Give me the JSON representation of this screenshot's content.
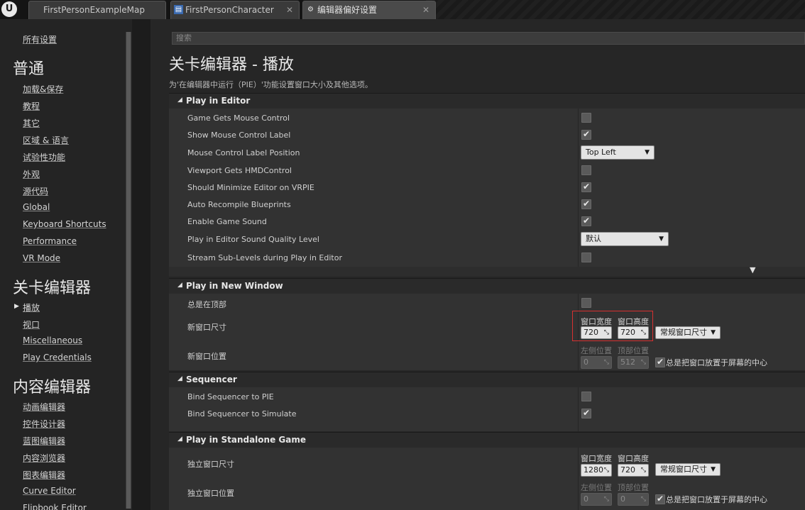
{
  "tabs": [
    {
      "label": "FirstPersonExampleMap",
      "icon": "level-icon"
    },
    {
      "label": "FirstPersonCharacter",
      "icon": "blueprint-icon"
    },
    {
      "label": "编辑器偏好设置",
      "icon": "settings-icon",
      "active": true
    }
  ],
  "sidebar": {
    "top_item": "所有设置",
    "sections": [
      {
        "heading": "普通",
        "items": [
          "加载&保存",
          "教程",
          "其它",
          "区域 & 语言",
          "试验性功能",
          "外观",
          "源代码",
          "Global",
          "Keyboard Shortcuts",
          "Performance",
          "VR Mode"
        ]
      },
      {
        "heading": "关卡编辑器",
        "items": [
          "播放",
          "视口",
          "Miscellaneous",
          "Play Credentials"
        ]
      },
      {
        "heading": "内容编辑器",
        "items": [
          "动画编辑器",
          "控件设计器",
          "蓝图编辑器",
          "内容浏览器",
          "图表编辑器",
          "Curve Editor",
          "Flipbook Editor"
        ]
      }
    ]
  },
  "main": {
    "search_placeholder": "搜索",
    "title": "关卡编辑器 - 播放",
    "description": "为'在编辑器中运行（PIE）'功能设置窗口大小及其他选项。",
    "play_in_editor": {
      "header": "Play in Editor",
      "rows": [
        {
          "label": "Game Gets Mouse Control",
          "checked": false
        },
        {
          "label": "Show Mouse Control Label",
          "checked": true
        },
        {
          "label": "Mouse Control Label Position",
          "dropdown": "Top Left"
        },
        {
          "label": "Viewport Gets HMDControl",
          "checked": false
        },
        {
          "label": "Should Minimize Editor on VRPIE",
          "checked": true
        },
        {
          "label": "Auto Recompile Blueprints",
          "checked": true
        },
        {
          "label": "Enable Game Sound",
          "checked": true
        },
        {
          "label": "Play in Editor Sound Quality Level",
          "dropdown": "默认"
        },
        {
          "label": "Stream Sub-Levels during Play in Editor",
          "checked": false
        }
      ]
    },
    "play_in_new_window": {
      "header": "Play in New Window",
      "always_on_top_label": "总是在顶部",
      "size_label": "新窗口尺寸",
      "width_label": "窗口宽度",
      "height_label": "窗口高度",
      "width_value": "720",
      "height_value": "720",
      "preset_dropdown": "常规窗口尺寸",
      "position_label": "新窗口位置",
      "left_label": "左侧位置",
      "top_label": "顶部位置",
      "left_value": "0",
      "top_value": "512",
      "center_label": "总是把窗口放置于屏幕的中心"
    },
    "sequencer": {
      "header": "Sequencer",
      "rows": [
        {
          "label": "Bind Sequencer to PIE",
          "checked": false
        },
        {
          "label": "Bind Sequencer to Simulate",
          "checked": true
        }
      ]
    },
    "standalone": {
      "header": "Play in Standalone Game",
      "size_label": "独立窗口尺寸",
      "width_label": "窗口宽度",
      "height_label": "窗口高度",
      "width_value": "1280",
      "height_value": "720",
      "preset_dropdown": "常规窗口尺寸",
      "position_label": "独立窗口位置",
      "left_label": "左侧位置",
      "top_label": "顶部位置",
      "left_value": "0",
      "top_value": "0",
      "center_label": "总是把窗口放置于屏幕的中心"
    }
  },
  "colors": {
    "highlight_border": "#d83030",
    "background": "#262626",
    "panel": "#323232"
  }
}
